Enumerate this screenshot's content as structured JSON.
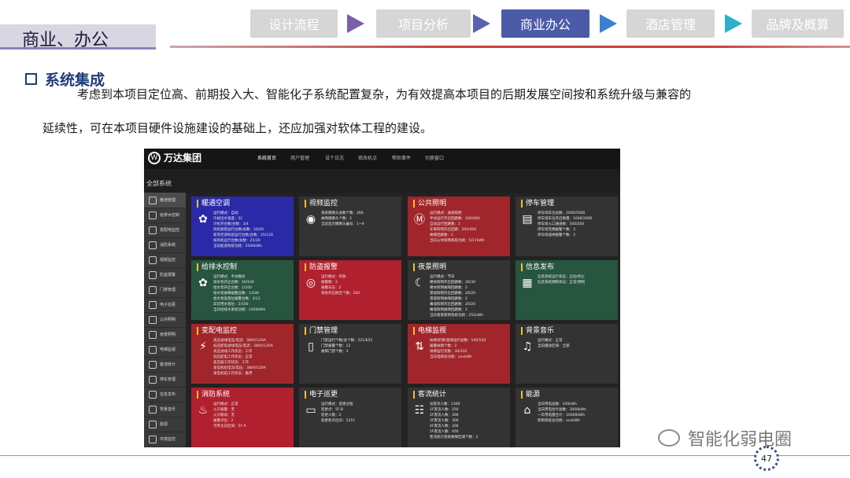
{
  "slide": {
    "title": "商业、办公",
    "steps": [
      {
        "label": "设计流程",
        "active": false
      },
      {
        "label": "项目分析",
        "active": false
      },
      {
        "label": "商业办公",
        "active": true
      },
      {
        "label": "酒店管理",
        "active": false
      },
      {
        "label": "品牌及概算",
        "active": false
      }
    ],
    "arrow_colors": [
      "#7b5fa8",
      "#5a62b0",
      "#3d7fd0",
      "#2fb0c8"
    ],
    "section_title": "系统集成",
    "paragraph_line1": "考虑到本项目定位高、前期投入大、智能化子系统配置复杂，为有效提高本项目的后期发展空间按和系统升级与兼容的",
    "paragraph_line2": "延续性，可在本项目硬件设施建设的基础上，还应加强对软体工程的建设。",
    "watermark": "智能化弱电圈",
    "page_number": "47"
  },
  "screenshot": {
    "brand": "万达集团",
    "nav": [
      "系统首页",
      "用户管理",
      "设个日志",
      "修改机点",
      "帮助事件",
      "切换窗口"
    ],
    "breadcrumb": "全部系统",
    "sidebar": [
      "暖通管理",
      "给排水控制",
      "变配电监控",
      "消防系统",
      "视频监控",
      "防盗报警",
      "门禁管理",
      "电子巡更",
      "公共照明",
      "夜景照明",
      "电梯监视",
      "客流统计",
      "停车管理",
      "信息发布",
      "背景音乐",
      "能源",
      "环境监控"
    ],
    "tiles": [
      {
        "title": "暖通空调",
        "color": "blue",
        "icon": "fan-icon",
        "glyph": "✿",
        "lines": [
          "运行模式：自动",
          "冷却出水温度：5C",
          "冷机开台数/台数：3/4",
          "风机盘管运行台数/总数：20/20",
          "新风空调机组运行台数/台数：25/120",
          "排风机运行台数/总数：25/30",
          "当前能源系统功耗：2500kWh"
        ]
      },
      {
        "title": "视频监控",
        "color": "grey",
        "icon": "camera-icon",
        "glyph": "◉",
        "lines": [
          "系统摄像头总数个数：266",
          "故障摄像头个数：2",
          "当前显示摄像头编号：1~9"
        ]
      },
      {
        "title": "公共照明",
        "color": "dred",
        "icon": "lamp-icon",
        "glyph": "Ⓜ",
        "lines": [
          "运行模式：通道照明",
          "手动运行开启回路数：200/400",
          "自动运行回路数：2",
          "车库照明开启回路：200/400",
          "故障回路数：2",
          "当日公共照明系统功耗：5/17kWh"
        ]
      },
      {
        "title": "停车管理",
        "color": "grey",
        "icon": "parking-icon",
        "glyph": "▤",
        "lines": [
          "停车场车位总数：2000/5000",
          "停车场车位开启数量：1000/2000",
          "停车场入口通道数：500/500",
          "停车场无偶报警个数：3",
          "停车场道闸报警个数：3"
        ]
      },
      {
        "title": "给排水控制",
        "color": "green",
        "icon": "water-icon",
        "glyph": "✿",
        "lines": [
          "运行模式：手动模式",
          "排水泵开启台数：50/100",
          "给水泵开启台数：1/100",
          "给水泵故障报警台数：1/100",
          "给水泵低液位报警台数：3/13",
          "非饮用水液位：2/100",
          "当日给排水系统功耗：1400kWh"
        ]
      },
      {
        "title": "防盗报警",
        "color": "crimson",
        "icon": "alarm-icon",
        "glyph": "◎",
        "lines": [
          "运行模式：布防",
          "报警数：2",
          "报警日志：2",
          "布防开启防区个数：200"
        ]
      },
      {
        "title": "夜景照明",
        "color": "grey",
        "icon": "moon-icon",
        "glyph": "☾",
        "lines": [
          "运行模式：节日",
          "楼体照明开启回路数：20/30",
          "楼体照明故障回路数：2",
          "景观照明开启回路数：20/20",
          "景观照明故障回路数：2",
          "幕墙照明开启回路数：20/20",
          "幕墙照明故障回路数：2",
          "当日夜景照明系统功耗：251kWh"
        ]
      },
      {
        "title": "信息发布",
        "color": "green",
        "icon": "screen-icon",
        "glyph": "▦",
        "lines": [
          "信息系统运行状态：启动/停止",
          "信息系统预制状态：正常/预制"
        ]
      },
      {
        "title": "变配电监控",
        "color": "dred",
        "icon": "power-icon",
        "glyph": "⚡",
        "lines": [
          "高压进线电压/电流：380V/120A",
          "低压配电进线电压/电流：380V/120A",
          "高压进线工作状态：工作",
          "低压配电工作状态：正常",
          "变压器工作状态：工作",
          "发电机组电流/电压：380V/120A",
          "发电机组工作状态：备用"
        ]
      },
      {
        "title": "门禁管理",
        "color": "grey",
        "icon": "door-icon",
        "glyph": "▯",
        "lines": [
          "门禁运行个数/总个数：521/655",
          "门禁报警个数：12",
          "故障门禁个数：3"
        ]
      },
      {
        "title": "电梯监视",
        "color": "dred",
        "icon": "elevator-icon",
        "glyph": "⇅",
        "lines": [
          "扶梯/阶梯/直梯运行总数：540/550",
          "报警扶梯个数：2",
          "扶梯运行次数：30/310",
          "当日电梯总功耗：xxxkWh"
        ]
      },
      {
        "title": "背景音乐",
        "color": "grey",
        "icon": "music-icon",
        "glyph": "♫",
        "lines": [
          "运行模式：正常",
          "当前播放区域：全部"
        ]
      },
      {
        "title": "消防系统",
        "color": "crimson",
        "icon": "fire-extinguisher-icon",
        "glyph": "♨",
        "lines": [
          "运行模式：正常",
          "火灾报警：无",
          "火灾联动：无",
          "报警点位：2",
          "可用主日区域：5F-A"
        ]
      },
      {
        "title": "电子巡更",
        "color": "grey",
        "icon": "phone-icon",
        "glyph": "▭",
        "lines": [
          "运行模式：巡更过程",
          "巡更点：5F-B",
          "巡更人数：2",
          "巡更机点位ID：5251"
        ]
      },
      {
        "title": "客流统计",
        "color": "grey",
        "icon": "people-icon",
        "glyph": "☷",
        "lines": [
          "总客流人数：2300",
          "1F客流人数：250",
          "2F客流人数：300",
          "3F客流人数：300",
          "4F客流人数：300",
          "5F客流人数：450",
          "客流统计系统故障区域个数：2"
        ]
      },
      {
        "title": "能源",
        "color": "grey",
        "icon": "home-energy-icon",
        "glyph": "⌂",
        "lines": [
          "当日用电总数：100kWh",
          "当日用电合计总数：3000kWh",
          "一年用电量合计：10000kWh",
          "照明系统总功耗：xxxkWh"
        ]
      }
    ]
  }
}
